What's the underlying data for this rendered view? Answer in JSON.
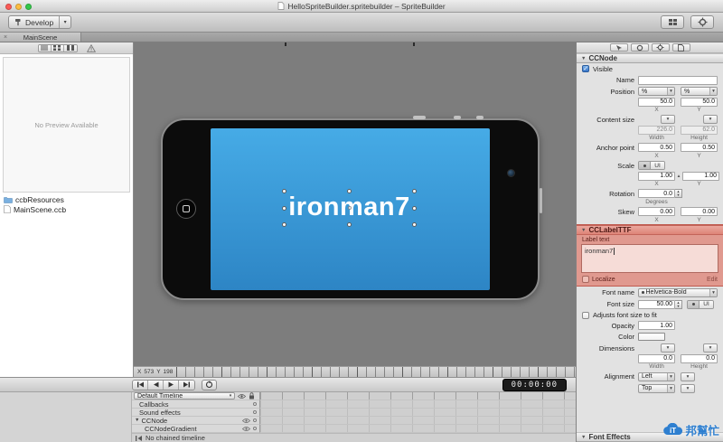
{
  "window": {
    "title": "HelloSpriteBuilder.spritebuilder – SpriteBuilder"
  },
  "toolbar": {
    "develop_label": "Develop"
  },
  "tabbar": {
    "tabs": [
      {
        "label": "MainScene"
      }
    ]
  },
  "sidebar": {
    "preview_placeholder": "No Preview Available",
    "files": [
      {
        "label": "ccbResources"
      },
      {
        "label": "MainScene.ccb"
      }
    ]
  },
  "canvas": {
    "label_text": "ironman7",
    "ruler_x_label": "X",
    "ruler_x_value": "573",
    "ruler_y_label": "Y",
    "ruler_y_value": "198"
  },
  "inspector": {
    "ccnode": {
      "title": "CCNode",
      "visible_label": "Visible",
      "name_label": "Name",
      "position_label": "Position",
      "percent": "%",
      "position_x": "50.0",
      "position_y": "50.0",
      "x_label": "X",
      "y_label": "Y",
      "content_size_label": "Content size",
      "content_w": "226.0",
      "content_h": "62.0",
      "width_label": "Width",
      "height_label": "Height",
      "anchor_label": "Anchor point",
      "anchor_x": "0.50",
      "anchor_y": "0.50",
      "scale_label": "Scale",
      "ui_label": "UI",
      "scale_x": "1.00",
      "scale_y": "1.00",
      "rotation_label": "Rotation",
      "rotation_value": "0.0",
      "degrees_label": "Degrees",
      "skew_label": "Skew",
      "skew_x": "0.00",
      "skew_y": "0.00"
    },
    "cclabelttf": {
      "title": "CCLabelTTF",
      "label_text_label": "Label text",
      "label_text_value": "ironman7",
      "localize_label": "Localize",
      "edit_label": "Edit",
      "font_name_label": "Font name",
      "font_name_value": "Helvetica-Bold",
      "font_size_label": "Font size",
      "font_size_value": "50.00",
      "ui_label": "UI",
      "adjusts_label": "Adjusts font size to fit",
      "opacity_label": "Opacity",
      "opacity_value": "1.00",
      "color_label": "Color",
      "dimensions_label": "Dimensions",
      "dimensions_w": "0.0",
      "dimensions_h": "0.0",
      "width_label": "Width",
      "height_label": "Height",
      "alignment_label": "Alignment",
      "alignment_value": "Left",
      "valignment_value": "Top"
    },
    "font_effects_title": "Font Effects"
  },
  "timeline": {
    "timecode": "00:00:00",
    "timeline_selector": "Default Timeline",
    "rows": [
      {
        "label": "Callbacks"
      },
      {
        "label": "Sound effects"
      },
      {
        "label": "CCNode"
      },
      {
        "label": "CCNodeGradient"
      }
    ],
    "chained_label": "No chained timeline"
  },
  "watermark": {
    "cloud_text": "iT",
    "text": "邦幫忙"
  },
  "icons": {
    "close": "×",
    "chevron_down": "▾",
    "chevron_up": "▴",
    "disclosure": "▼",
    "check": "✓"
  }
}
